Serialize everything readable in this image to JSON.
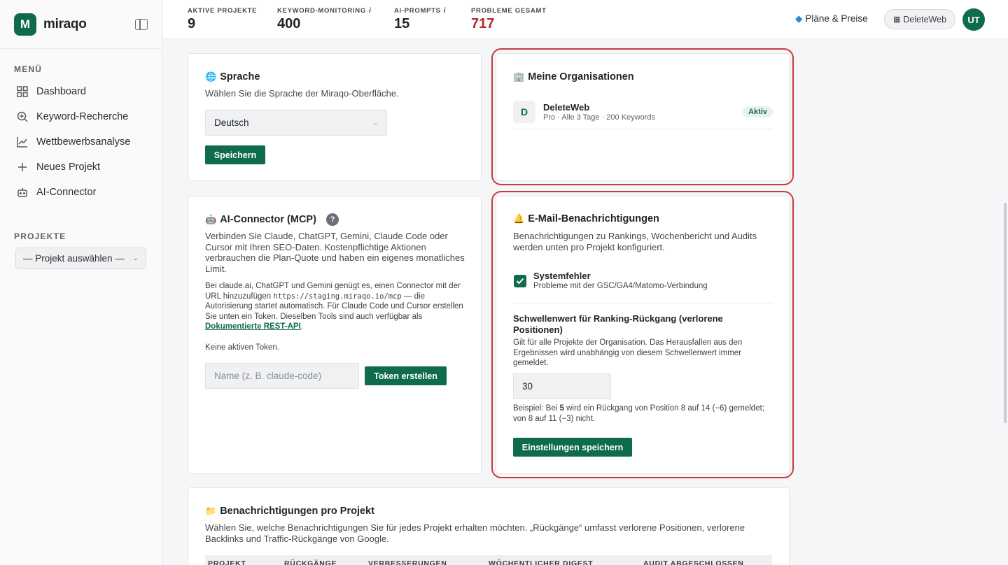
{
  "app": {
    "brand_name": "miraqo",
    "logo_letter": "M"
  },
  "sidebar": {
    "menu_label": "MENÜ",
    "items": [
      {
        "label": "Dashboard",
        "icon": "grid-icon"
      },
      {
        "label": "Keyword-Recherche",
        "icon": "search-plus-icon"
      },
      {
        "label": "Wettbewerbsanalyse",
        "icon": "chart-line-icon"
      },
      {
        "label": "Neues Projekt",
        "icon": "plus-icon"
      },
      {
        "label": "AI-Connector",
        "icon": "robot-icon"
      }
    ],
    "projects_label": "PROJEKTE",
    "project_select": "— Projekt auswählen —"
  },
  "header": {
    "stats": [
      {
        "label": "AKTIVE PROJEKTE",
        "value": "9",
        "info": ""
      },
      {
        "label": "KEYWORD-MONITORING",
        "value": "400",
        "info": "i"
      },
      {
        "label": "AI-PROMPTS",
        "value": "15",
        "info": "i"
      },
      {
        "label": "PROBLEME GESAMT",
        "value": "717",
        "info": ""
      }
    ],
    "plans_label": "Pläne & Preise",
    "org_pill": "DeleteWeb",
    "avatar_initials": "UT"
  },
  "language_card": {
    "title": "Sprache",
    "description": "Wählen Sie die Sprache der Miraqo-Oberfläche.",
    "selected_language": "Deutsch",
    "save_button": "Speichern"
  },
  "organizations_card": {
    "title": "Meine Organisationen",
    "org": {
      "initial": "D",
      "name": "DeleteWeb",
      "meta": "Pro · Alle 3 Tage · 200 Keywords",
      "badge": "Aktiv"
    }
  },
  "ai_connector_card": {
    "title": "AI-Connector (MCP)",
    "help": "?",
    "intro": "Verbinden Sie Claude, ChatGPT, Gemini, Claude Code oder Cursor mit Ihren SEO-Daten. Kostenpflichtige Aktionen verbrauchen die Plan-Quote und haben ein eigenes monatliches Limit.",
    "details_before_url": "Bei claude.ai, ChatGPT und Gemini genügt es, einen Connector mit der URL hinzuzufügen",
    "url": "https://staging.miraqo.io/mcp",
    "details_after_url": "— die Autorisierung startet automatisch. Für Claude Code und Cursor erstellen Sie unten ein Token. Dieselben Tools sind auch verfügbar als",
    "api_link": "Dokumentierte REST-API",
    "details_end": ".",
    "no_tokens": "Keine aktiven Token.",
    "token_name_placeholder": "Name (z. B. claude-code)",
    "create_token_button": "Token erstellen"
  },
  "email_card": {
    "title": "E-Mail-Benachrichtigungen",
    "description": "Benachrichtigungen zu Rankings, Wochenbericht und Audits werden unten pro Projekt konfiguriert.",
    "system_errors": {
      "label": "Systemfehler",
      "sublabel": "Probleme mit der GSC/GA4/Matomo-Verbindung",
      "checked": true
    },
    "threshold_title": "Schwellenwert für Ranking-Rückgang (verlorene Positionen)",
    "threshold_desc": "Gilt für alle Projekte der Organisation. Das Herausfallen aus den Ergebnissen wird unabhängig von diesem Schwellenwert immer gemeldet.",
    "threshold_value": "30",
    "example_before": "Beispiel: Bei",
    "example_num": "5",
    "example_after": "wird ein Rückgang von Position 8 auf 14 (−6) gemeldet; von 8 auf 11 (−3) nicht.",
    "save_button": "Einstellungen speichern"
  },
  "project_notifications_card": {
    "title": "Benachrichtigungen pro Projekt",
    "description": "Wählen Sie, welche Benachrichtigungen Sie für jedes Projekt erhalten möchten. „Rückgänge“ umfasst verlorene Positionen, verlorene Backlinks und Traffic-Rückgänge von Google.",
    "columns": [
      "PROJEKT",
      "RÜCKGÄNGE",
      "VERBESSERUNGEN",
      "WÖCHENTLICHER DIGEST",
      "AUDIT ABGESCHLOSSEN"
    ]
  },
  "colors": {
    "brand": "#0e6b4c",
    "highlight": "#c93a3f",
    "problems": "#b02a2f"
  }
}
